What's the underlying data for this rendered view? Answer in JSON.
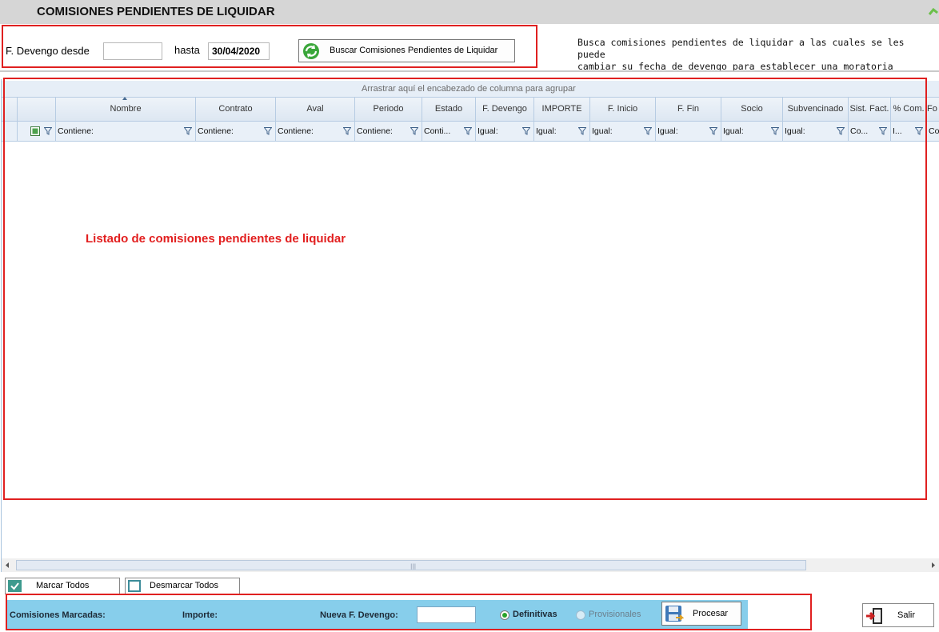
{
  "window": {
    "title": "COMISIONES PENDIENTES DE LIQUIDAR"
  },
  "filters": {
    "desde_label": "F. Devengo desde",
    "desde_value": "",
    "hasta_label": "hasta",
    "hasta_value": "30/04/2020",
    "search_button_label": "Buscar Comisiones Pendientes de Liquidar",
    "description_line1": "Busca comisiones pendientes de liquidar a las cuales se les puede",
    "description_line2": "cambiar su fecha de devengo para establecer una moratoria"
  },
  "grid": {
    "group_hint": "Arrastrar aquí el encabezado de columna para agrupar",
    "columns": [
      "Nombre",
      "Contrato",
      "Aval",
      "Periodo",
      "Estado",
      "F. Devengo",
      "IMPORTE",
      "F. Inicio",
      "F. Fin",
      "Socio",
      "Subvencinado",
      "Sist. Fact.",
      "% Com.",
      "Fo"
    ],
    "filters": [
      "Contiene:",
      "Contiene:",
      "Contiene:",
      "Contiene:",
      "Conti...",
      "Igual:",
      "Igual:",
      "Igual:",
      "Igual:",
      "Igual:",
      "Igual:",
      "Co...",
      "I...",
      "Co"
    ],
    "sorted_column": "Nombre",
    "empty_note": "Listado de comisiones pendientes de liquidar"
  },
  "actions": {
    "mark_all_label": "Marcar Todos",
    "unmark_all_label": "Desmarcar Todos"
  },
  "process": {
    "marked_label": "Comisiones Marcadas:",
    "importe_label": "Importe:",
    "new_date_label": "Nueva F. Devengo:",
    "new_date_value": "",
    "radio_definitivas": "Definitivas",
    "radio_provisionales": "Provisionales",
    "selected_radio": "Definitivas",
    "process_button_label": "Procesar",
    "exit_button_label": "Salir"
  },
  "colors": {
    "title_bar": "#d6d6d6",
    "panel": "#87ceeb",
    "annotation": "#e02020",
    "grid_header": "#e6eef7"
  },
  "icons": [
    "refresh-icon",
    "filter-icon",
    "checkbox-icon",
    "save-icon",
    "exit-icon",
    "sort-ascending-icon"
  ]
}
